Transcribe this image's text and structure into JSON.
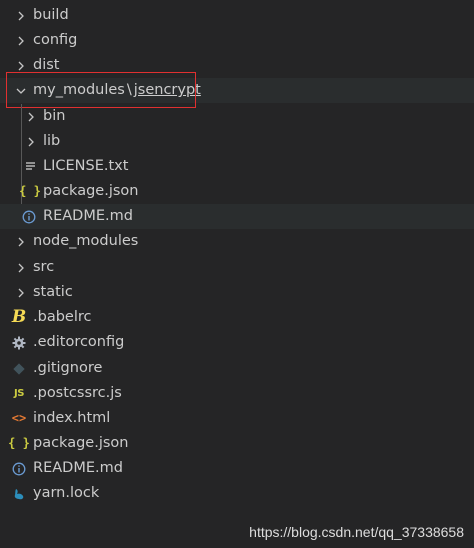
{
  "explorer": {
    "items": [
      {
        "name": "build",
        "type": "folder"
      },
      {
        "name": "config",
        "type": "folder"
      },
      {
        "name": "dist",
        "type": "folder"
      },
      {
        "compact_folder": {
          "parent": "my_modules",
          "separator": "\\",
          "child": "jsencrypt"
        },
        "type": "folder-open"
      },
      {
        "name": "bin",
        "type": "folder"
      },
      {
        "name": "lib",
        "type": "folder"
      },
      {
        "name": "LICENSE.txt",
        "type": "file",
        "icon": "lines-icon"
      },
      {
        "name": "package.json",
        "type": "file",
        "icon": "json-braces-icon"
      },
      {
        "name": "README.md",
        "type": "file",
        "icon": "info-icon"
      },
      {
        "name": "node_modules",
        "type": "folder"
      },
      {
        "name": "src",
        "type": "folder"
      },
      {
        "name": "static",
        "type": "folder"
      },
      {
        "name": ".babelrc",
        "type": "file",
        "icon": "babel-icon"
      },
      {
        "name": ".editorconfig",
        "type": "file",
        "icon": "gear-icon"
      },
      {
        "name": ".gitignore",
        "type": "file",
        "icon": "git-diamond-icon"
      },
      {
        "name": ".postcssrc.js",
        "type": "file",
        "icon": "js-icon"
      },
      {
        "name": "index.html",
        "type": "file",
        "icon": "html-icon"
      },
      {
        "name": "package.json",
        "type": "file",
        "icon": "json-braces-icon"
      },
      {
        "name": "README.md",
        "type": "file",
        "icon": "info-icon"
      },
      {
        "name": "yarn.lock",
        "type": "file",
        "icon": "yarn-icon"
      }
    ],
    "icons": {
      "js_label": "JS",
      "json_label": "{ }",
      "babel_label": "B",
      "html_label": "<>"
    }
  },
  "watermark": "https://blog.csdn.net/qq_37338658",
  "colors": {
    "background": "#252526",
    "text": "#cccccc",
    "chevron": "#c5c5c5",
    "hover_row": "#2a2d2e",
    "highlight_border": "#e03030",
    "json_yellow": "#cbcb41",
    "info_blue": "#6b9bd2",
    "html_orange": "#e37933",
    "git_gray": "#41535b",
    "yarn_blue": "#2c8ebb"
  }
}
